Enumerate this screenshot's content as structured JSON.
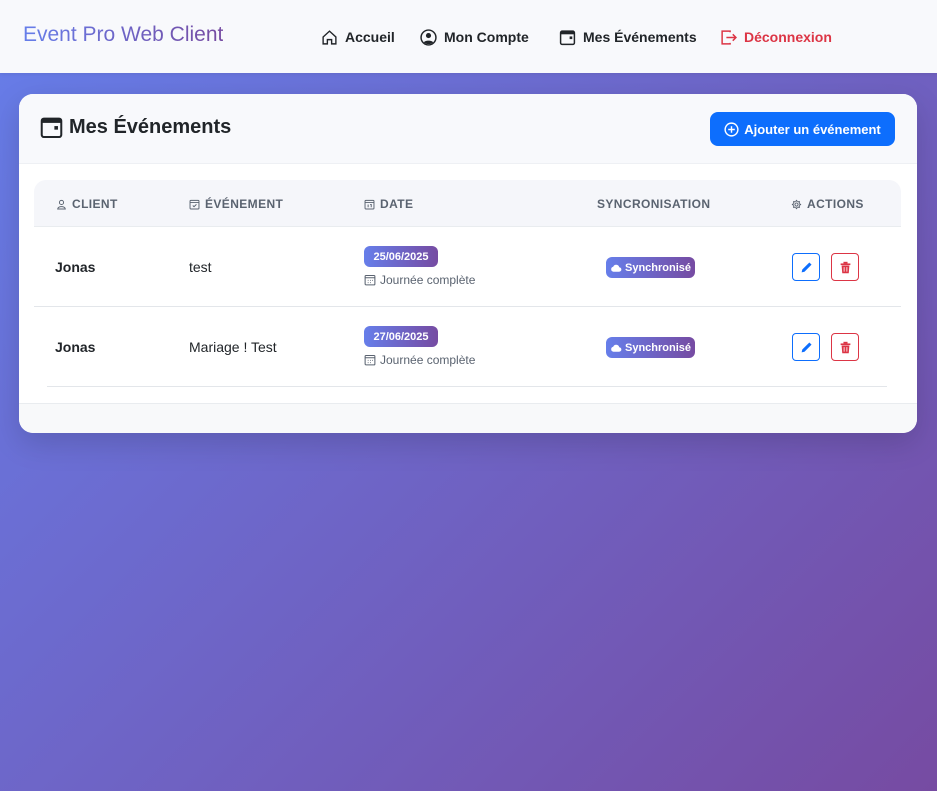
{
  "navbar": {
    "brand": "Event Pro Web Client",
    "items": [
      {
        "label": "Accueil",
        "icon": "home-icon"
      },
      {
        "label": "Mon Compte",
        "icon": "user-circle-icon"
      },
      {
        "label": "Mes Événements",
        "icon": "calendar-icon"
      },
      {
        "label": "Déconnexion",
        "icon": "logout-icon"
      }
    ]
  },
  "card": {
    "title": "Mes Événements",
    "add_button": "Ajouter un événement"
  },
  "table": {
    "headers": {
      "client": "CLIENT",
      "event": "ÉVÉNEMENT",
      "date": "DATE",
      "sync": "SYNCRONISATION",
      "actions": "ACTIONS"
    },
    "rows": [
      {
        "client": "Jonas",
        "event": "test",
        "date": "25/06/2025",
        "date_sub": "Journée complète",
        "sync": "Synchronisé"
      },
      {
        "client": "Jonas",
        "event": "Mariage ! Test",
        "date": "27/06/2025",
        "date_sub": "Journée complète",
        "sync": "Synchronisé"
      }
    ]
  },
  "colors": {
    "gradient_start": "#667eea",
    "gradient_end": "#764ba2",
    "primary": "#0d6efd",
    "danger": "#dc3545"
  }
}
